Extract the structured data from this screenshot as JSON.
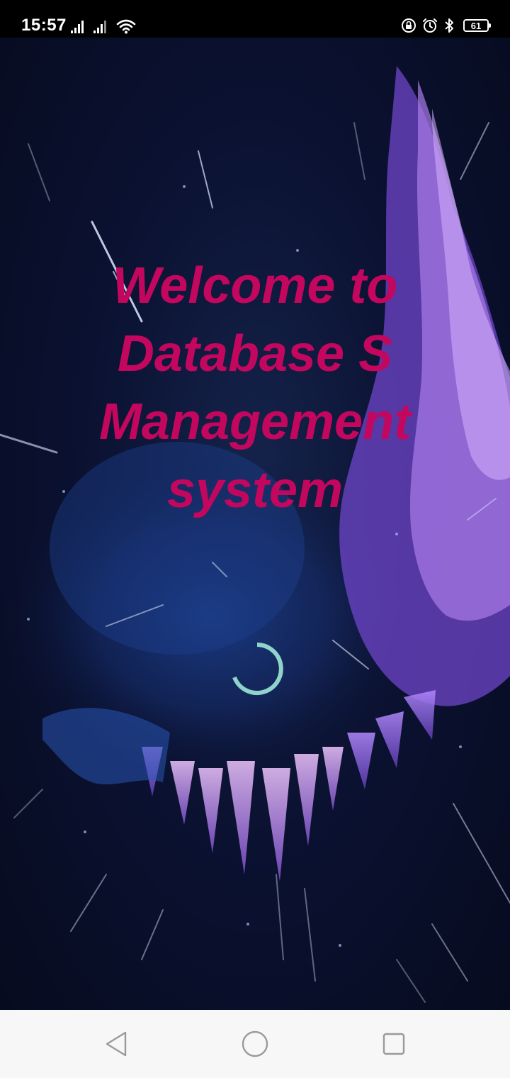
{
  "status_bar": {
    "time": "15:57",
    "battery_level": "61",
    "icons": [
      "signal-icon",
      "signal-icon",
      "wifi-icon",
      "lock-rotation-icon",
      "alarm-icon",
      "bluetooth-icon",
      "battery-icon"
    ]
  },
  "welcome": {
    "line1": "Welcome to",
    "line2": "Database S",
    "line3": "Management",
    "line4": "system",
    "color": "#c3075e"
  },
  "spinner": {
    "color": "#8fd3cb"
  },
  "nav_bar": {
    "buttons": [
      "back-icon",
      "home-icon",
      "recents-icon"
    ]
  }
}
